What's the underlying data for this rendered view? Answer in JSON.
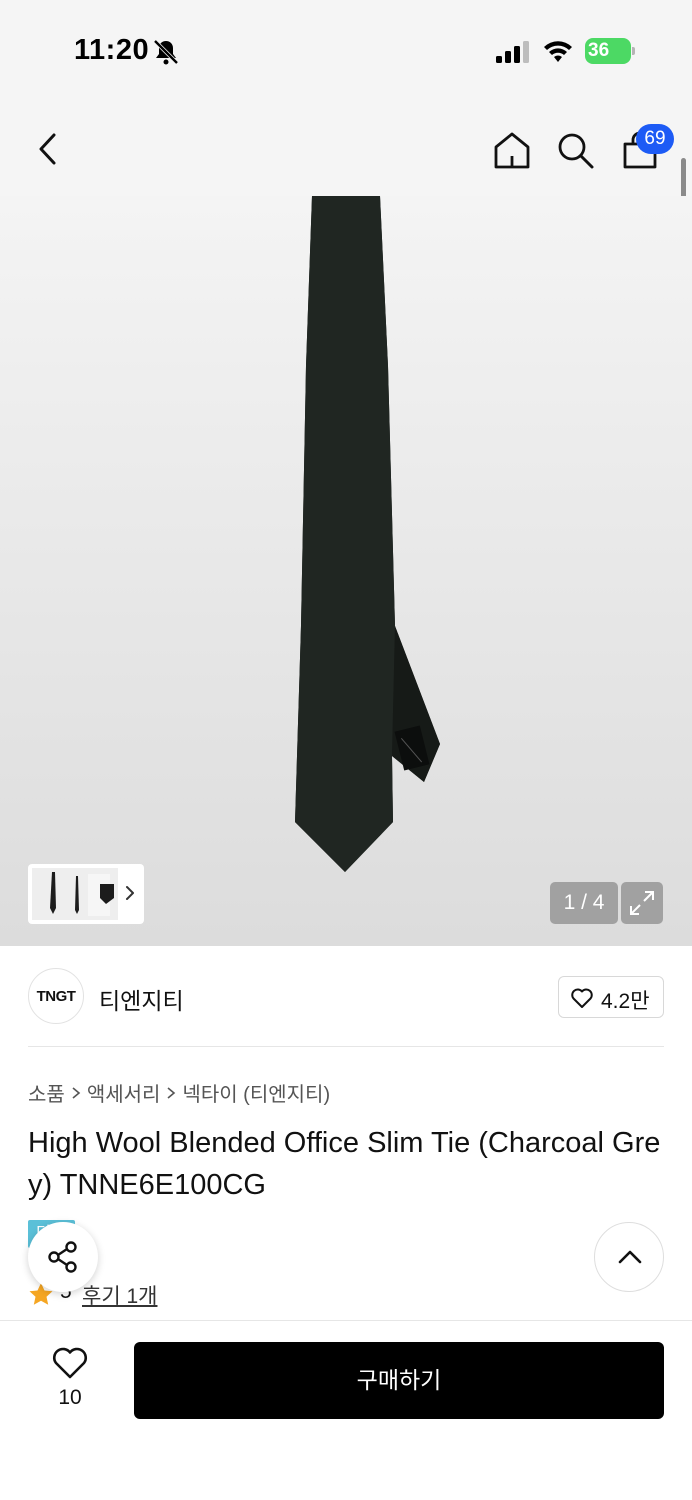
{
  "status": {
    "time": "11:20",
    "battery": "36"
  },
  "header": {
    "cart_count": "69"
  },
  "gallery": {
    "counter": "1 / 4"
  },
  "brand": {
    "logo_text": "TNGT",
    "name": "티엔지티",
    "likes": "4.2만"
  },
  "breadcrumb": [
    "소품",
    "액세서리",
    "넥타이 (티엔지티)"
  ],
  "product": {
    "title": "High Wool Blended Office Slim Tie (Charcoal Grey) TNNE6E100CG",
    "tag": "단독",
    "rating": "5",
    "reviews": "후기 1개"
  },
  "bottom": {
    "wish_count": "10",
    "buy_label": "구매하기"
  },
  "colors": {
    "accent_blue": "#1d5bf5",
    "battery_green": "#4cd964",
    "tag_cyan": "#5bc0d8",
    "star_orange": "#f5a623",
    "tie": "#1c211e"
  }
}
